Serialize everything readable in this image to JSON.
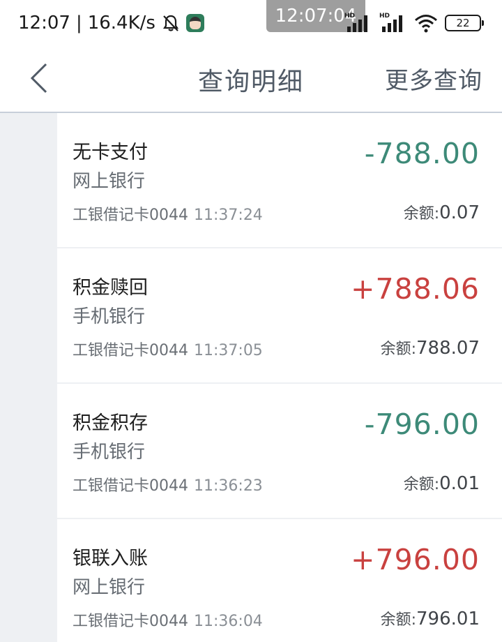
{
  "status_bar": {
    "time": "12:07",
    "separator": "|",
    "net_speed": "16.4K/s",
    "clock_pill": "12:07:04",
    "signal_label": "HD",
    "battery": "22"
  },
  "nav": {
    "title": "查询明细",
    "more": "更多查询"
  },
  "transactions": [
    {
      "title": "无卡支付",
      "channel": "网上银行",
      "card": "工银借记卡0044",
      "time": "11:37:24",
      "amount": "-788.00",
      "direction": "out",
      "balance_label": "余额:",
      "balance": "0.07"
    },
    {
      "title": "积金赎回",
      "channel": "手机银行",
      "card": "工银借记卡0044",
      "time": "11:37:05",
      "amount": "+788.06",
      "direction": "in",
      "balance_label": "余额:",
      "balance": "788.07"
    },
    {
      "title": "积金积存",
      "channel": "手机银行",
      "card": "工银借记卡0044",
      "time": "11:36:23",
      "amount": "-796.00",
      "direction": "out",
      "balance_label": "余额:",
      "balance": "0.01"
    },
    {
      "title": "银联入账",
      "channel": "网上银行",
      "card": "工银借记卡0044",
      "time": "11:36:04",
      "amount": "+796.00",
      "direction": "in",
      "balance_label": "余额:",
      "balance": "796.01"
    }
  ],
  "colors": {
    "amount_out": "#3d8a78",
    "amount_in": "#c9413f",
    "nav_text": "#505a66"
  }
}
